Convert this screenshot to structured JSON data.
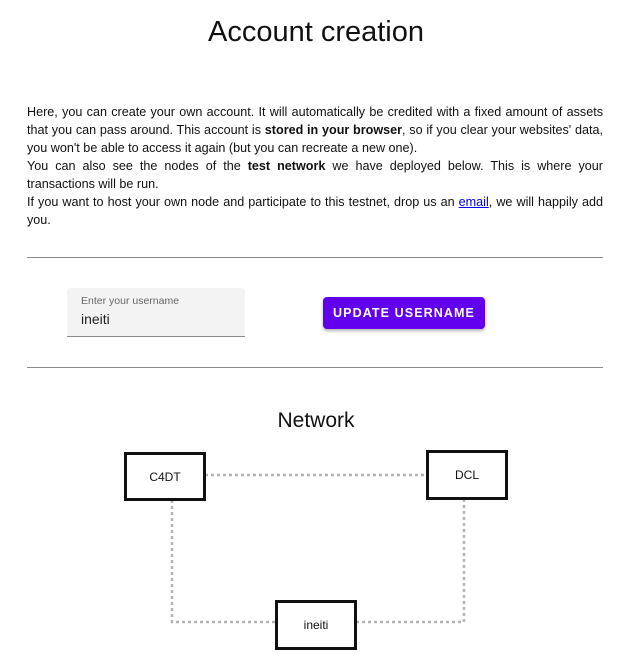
{
  "page": {
    "title": "Account creation"
  },
  "intro": {
    "p1_a": "Here, you can create your own account. It will automatically be credited with a fixed amount of assets that you can pass around. This account is ",
    "p1_b": "stored in your browser",
    "p1_c": ", so if you clear your websites' data, you won't be able to access it again (but you can recreate a new one).",
    "p2_a": "You can also see the nodes of the ",
    "p2_b": "test network",
    "p2_c": " we have deployed below. This is where your transactions will be run.",
    "p3_a": "If you want to host your own node and participate to this testnet, drop us an ",
    "p3_link": "email",
    "p3_c": ", we will happily add you."
  },
  "username": {
    "label": "Enter your username",
    "value": "ineiti"
  },
  "actions": {
    "update_label": "UPDATE USERNAME"
  },
  "network": {
    "title": "Network",
    "nodes": [
      "C4DT",
      "DCL",
      "ineiti"
    ]
  },
  "colors": {
    "accent": "#6200ee",
    "link": "#0000ee",
    "edge": "#b4b4b4"
  }
}
